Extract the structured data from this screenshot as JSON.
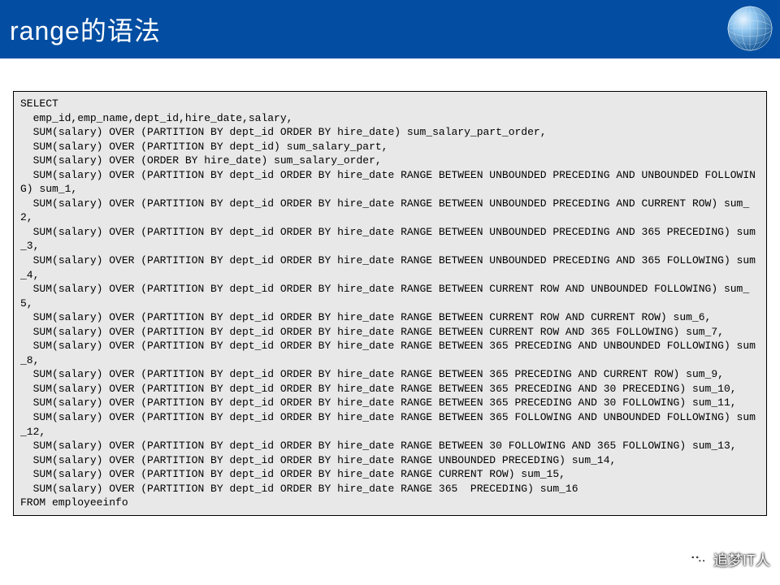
{
  "header": {
    "title": "range的语法"
  },
  "code": {
    "text": "SELECT\n  emp_id,emp_name,dept_id,hire_date,salary,\n  SUM(salary) OVER (PARTITION BY dept_id ORDER BY hire_date) sum_salary_part_order,\n  SUM(salary) OVER (PARTITION BY dept_id) sum_salary_part,\n  SUM(salary) OVER (ORDER BY hire_date) sum_salary_order,\n  SUM(salary) OVER (PARTITION BY dept_id ORDER BY hire_date RANGE BETWEEN UNBOUNDED PRECEDING AND UNBOUNDED FOLLOWING) sum_1,\n  SUM(salary) OVER (PARTITION BY dept_id ORDER BY hire_date RANGE BETWEEN UNBOUNDED PRECEDING AND CURRENT ROW) sum_2,\n  SUM(salary) OVER (PARTITION BY dept_id ORDER BY hire_date RANGE BETWEEN UNBOUNDED PRECEDING AND 365 PRECEDING) sum_3,\n  SUM(salary) OVER (PARTITION BY dept_id ORDER BY hire_date RANGE BETWEEN UNBOUNDED PRECEDING AND 365 FOLLOWING) sum_4,\n  SUM(salary) OVER (PARTITION BY dept_id ORDER BY hire_date RANGE BETWEEN CURRENT ROW AND UNBOUNDED FOLLOWING) sum_5,\n  SUM(salary) OVER (PARTITION BY dept_id ORDER BY hire_date RANGE BETWEEN CURRENT ROW AND CURRENT ROW) sum_6,\n  SUM(salary) OVER (PARTITION BY dept_id ORDER BY hire_date RANGE BETWEEN CURRENT ROW AND 365 FOLLOWING) sum_7,\n  SUM(salary) OVER (PARTITION BY dept_id ORDER BY hire_date RANGE BETWEEN 365 PRECEDING AND UNBOUNDED FOLLOWING) sum_8,\n  SUM(salary) OVER (PARTITION BY dept_id ORDER BY hire_date RANGE BETWEEN 365 PRECEDING AND CURRENT ROW) sum_9,\n  SUM(salary) OVER (PARTITION BY dept_id ORDER BY hire_date RANGE BETWEEN 365 PRECEDING AND 30 PRECEDING) sum_10,\n  SUM(salary) OVER (PARTITION BY dept_id ORDER BY hire_date RANGE BETWEEN 365 PRECEDING AND 30 FOLLOWING) sum_11,\n  SUM(salary) OVER (PARTITION BY dept_id ORDER BY hire_date RANGE BETWEEN 365 FOLLOWING AND UNBOUNDED FOLLOWING) sum_12,\n  SUM(salary) OVER (PARTITION BY dept_id ORDER BY hire_date RANGE BETWEEN 30 FOLLOWING AND 365 FOLLOWING) sum_13,\n  SUM(salary) OVER (PARTITION BY dept_id ORDER BY hire_date RANGE UNBOUNDED PRECEDING) sum_14,\n  SUM(salary) OVER (PARTITION BY dept_id ORDER BY hire_date RANGE CURRENT ROW) sum_15,\n  SUM(salary) OVER (PARTITION BY dept_id ORDER BY hire_date RANGE 365  PRECEDING) sum_16\nFROM employeeinfo"
  },
  "watermark": {
    "text": "追梦IT人"
  }
}
